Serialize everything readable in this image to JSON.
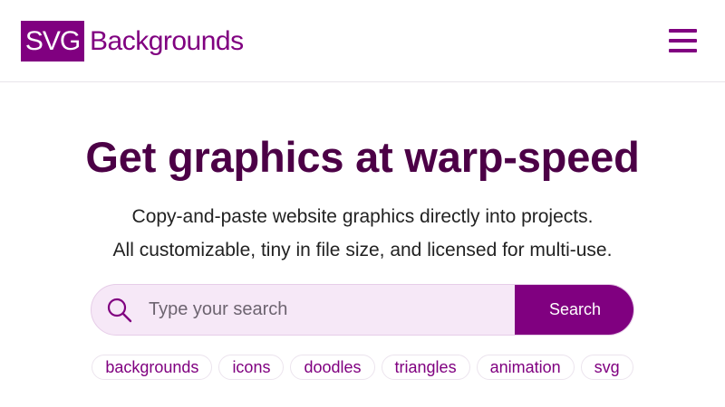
{
  "header": {
    "logo_mark": "SVG",
    "logo_text": "Backgrounds",
    "menu_icon": "hamburger-menu-icon"
  },
  "hero": {
    "title": "Get graphics at warp-speed",
    "subtitle_line1": "Copy-and-paste website graphics directly into projects.",
    "subtitle_line2": "All customizable, tiny in file size, and licensed for multi-use."
  },
  "search": {
    "icon": "search-icon",
    "placeholder": "Type your search",
    "value": "",
    "button_label": "Search"
  },
  "tags": [
    "backgrounds",
    "icons",
    "doodles",
    "triangles",
    "animation",
    "svg"
  ],
  "colors": {
    "brand": "#800080",
    "title": "#4c0046",
    "search_bg": "#f6e8f7"
  }
}
